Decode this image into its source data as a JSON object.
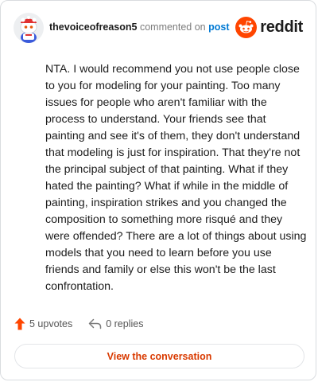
{
  "comment": {
    "username": "thevoiceofreason5",
    "action_text": "commented on",
    "target_text": "post",
    "body": "NTA. I would recommend you not use people close to you for modeling for your painting. Too many issues for people who aren't familiar with the process to understand. Your friends see that painting and see it's of them, they don't understand that modeling is just for inspiration. That they're not the principal subject of that painting. What if they hated the painting? What if while in the middle of painting, inspiration strikes and you changed the composition to something more risqué and they were offended? There are a lot of things about using models that you need to learn before you use friends and family or else this won't be the last confrontation."
  },
  "brand": {
    "wordmark": "reddit",
    "color": "#ff4500"
  },
  "stats": {
    "upvotes": "5 upvotes",
    "replies": "0 replies",
    "upvote_icon": "upvote-arrow-icon",
    "reply_icon": "reply-arrow-icon"
  },
  "cta": {
    "label": "View the conversation",
    "color": "#d93a00"
  },
  "colors": {
    "link": "#0079d3",
    "text": "#1c1c1c",
    "muted": "#7c7c7c"
  }
}
